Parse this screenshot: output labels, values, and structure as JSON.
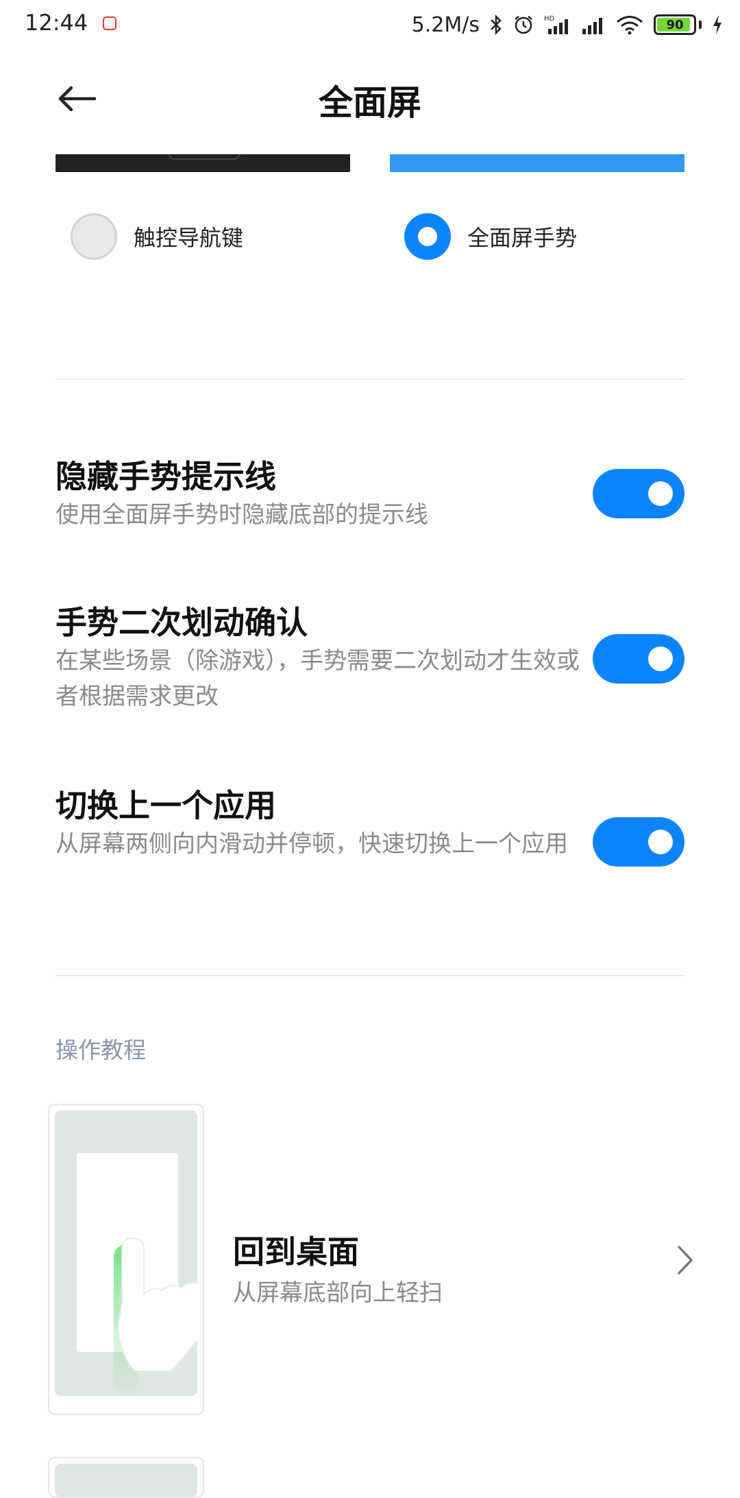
{
  "status_bar": {
    "time": "12:44",
    "network_speed": "5.2M/s",
    "battery_level": "90",
    "icons": [
      "app-notification-icon",
      "bluetooth-icon",
      "alarm-icon",
      "hd-signal-icon",
      "signal-icon",
      "wifi-icon",
      "battery-icon",
      "charging-icon"
    ]
  },
  "header": {
    "title": "全面屏",
    "back_icon": "back-arrow-icon"
  },
  "navigation_mode": {
    "options": [
      {
        "label": "触控导航键",
        "selected": false
      },
      {
        "label": "全面屏手势",
        "selected": true
      }
    ],
    "accent_color": "#0d84ff"
  },
  "settings": [
    {
      "title": "隐藏手势提示线",
      "desc": "使用全面屏手势时隐藏底部的提示线",
      "enabled": true
    },
    {
      "title": "手势二次划动确认",
      "desc": "在某些场景（除游戏），手势需要二次划动才生效或者根据需求更改",
      "enabled": true
    },
    {
      "title": "切换上一个应用",
      "desc": "从屏幕两侧向内滑动并停顿，快速切换上一个应用",
      "enabled": true
    }
  ],
  "tutorial": {
    "section_title": "操作教程",
    "items": [
      {
        "title": "回到桌面",
        "desc": "从屏幕底部向上轻扫",
        "chevron_icon": "chevron-right-icon"
      }
    ]
  }
}
